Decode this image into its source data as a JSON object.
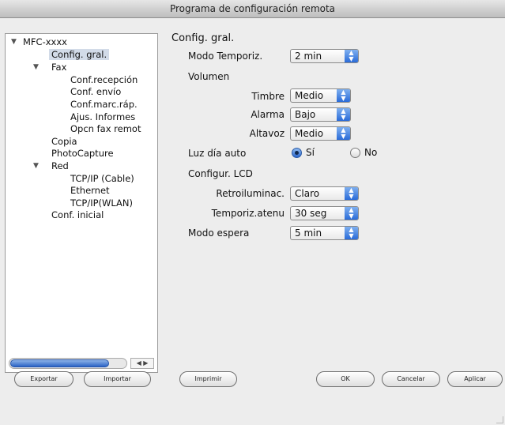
{
  "window": {
    "title": "Programa de configuración remota"
  },
  "tree": {
    "items": [
      {
        "label": "MFC-xxxx"
      },
      {
        "label": "Config. gral."
      },
      {
        "label": "Fax"
      },
      {
        "label": "Conf.recepción"
      },
      {
        "label": "Conf. envío"
      },
      {
        "label": "Conf.marc.ráp."
      },
      {
        "label": "Ajus. Informes"
      },
      {
        "label": "Opcn fax remot"
      },
      {
        "label": "Copia"
      },
      {
        "label": "PhotoCapture"
      },
      {
        "label": "Red"
      },
      {
        "label": "TCP/IP (Cable)"
      },
      {
        "label": "Ethernet"
      },
      {
        "label": "TCP/IP(WLAN)"
      },
      {
        "label": "Conf. inicial"
      }
    ],
    "selected": "Config. gral."
  },
  "settings": {
    "section_title": "Config. gral.",
    "modo_temporiz": {
      "label": "Modo Temporiz.",
      "value": "2 min"
    },
    "volumen_label": "Volumen",
    "timbre": {
      "label": "Timbre",
      "value": "Medio"
    },
    "alarma": {
      "label": "Alarma",
      "value": "Bajo"
    },
    "altavoz": {
      "label": "Altavoz",
      "value": "Medio"
    },
    "luz_dia_auto": {
      "label": "Luz día auto",
      "option_yes": "Sí",
      "option_no": "No",
      "selected": "Sí"
    },
    "configur_lcd_label": "Configur. LCD",
    "retroiluminac": {
      "label": "Retroiluminac.",
      "value": "Claro"
    },
    "temporiz_atenu": {
      "label": "Temporiz.atenu",
      "value": "30 seg"
    },
    "modo_espera": {
      "label": "Modo espera",
      "value": "5 min"
    }
  },
  "buttons": {
    "exportar": "Exportar",
    "importar": "Importar",
    "imprimir": "Imprimir",
    "ok": "OK",
    "cancelar": "Cancelar",
    "aplicar": "Aplicar"
  },
  "colors": {
    "selection": "#d2dbe8",
    "accent": "#2a6bd8"
  }
}
